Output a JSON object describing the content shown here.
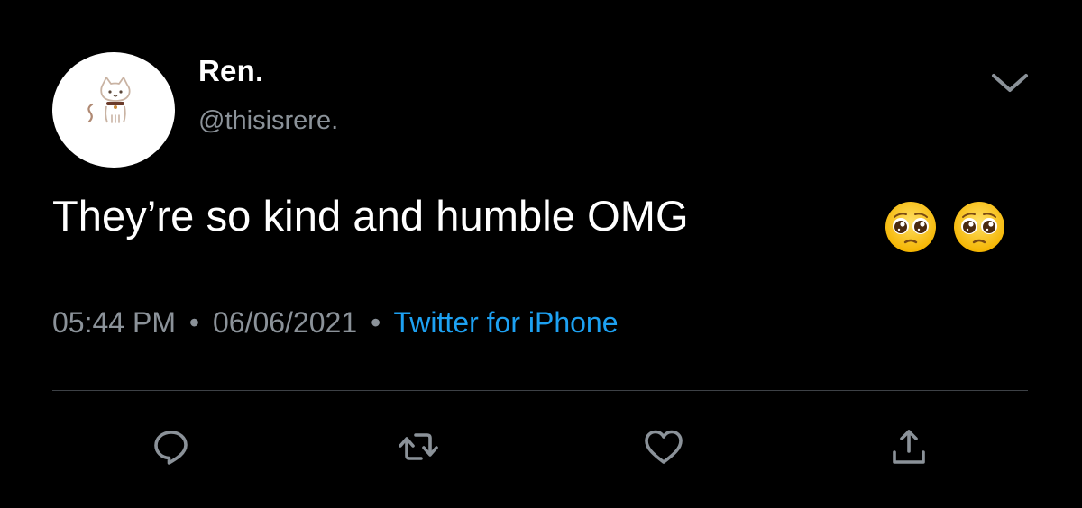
{
  "tweet": {
    "display_name": "Ren.",
    "handle": "@thisisrere.",
    "text": "They’re so kind and humble OMG",
    "emojis": [
      "pleading-face-emoji",
      "pleading-face-emoji"
    ],
    "time": "05:44 PM",
    "separator": "•",
    "date": "06/06/2021",
    "source": "Twitter for iPhone"
  },
  "icons": {
    "menu": "chevron-down-icon",
    "reply": "reply-icon",
    "retweet": "retweet-icon",
    "like": "heart-icon",
    "share": "share-icon"
  },
  "colors": {
    "background": "#000000",
    "text": "#ffffff",
    "secondary": "#8b9299",
    "link": "#1da1f2",
    "divider": "#3d4146"
  }
}
